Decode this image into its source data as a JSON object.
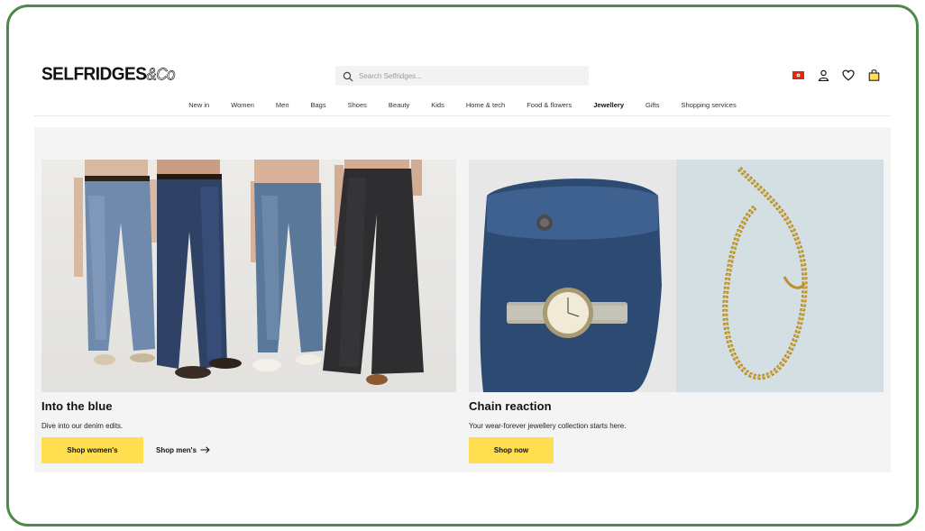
{
  "header": {
    "logo": "SELFRIDGES",
    "logo_suffix": "&Co",
    "search_placeholder": "Search Selfridges..."
  },
  "nav": {
    "items": [
      "New in",
      "Women",
      "Men",
      "Bags",
      "Shoes",
      "Beauty",
      "Kids",
      "Home & tech",
      "Food & flowers",
      "Jewellery",
      "Gifts",
      "Shopping services"
    ],
    "active": "Jewellery"
  },
  "promos": [
    {
      "title": "Into the blue",
      "subtitle": "Dive into our denim edits.",
      "primary_button": "Shop women's",
      "secondary_link": "Shop men's"
    },
    {
      "title": "Chain reaction",
      "subtitle": "Your wear-forever jewellery collection starts here.",
      "primary_button": "Shop now"
    }
  ],
  "colors": {
    "frame": "#4e8a4a",
    "accent_yellow": "#ffdf4f",
    "panel_bg": "#f4f4f4"
  }
}
